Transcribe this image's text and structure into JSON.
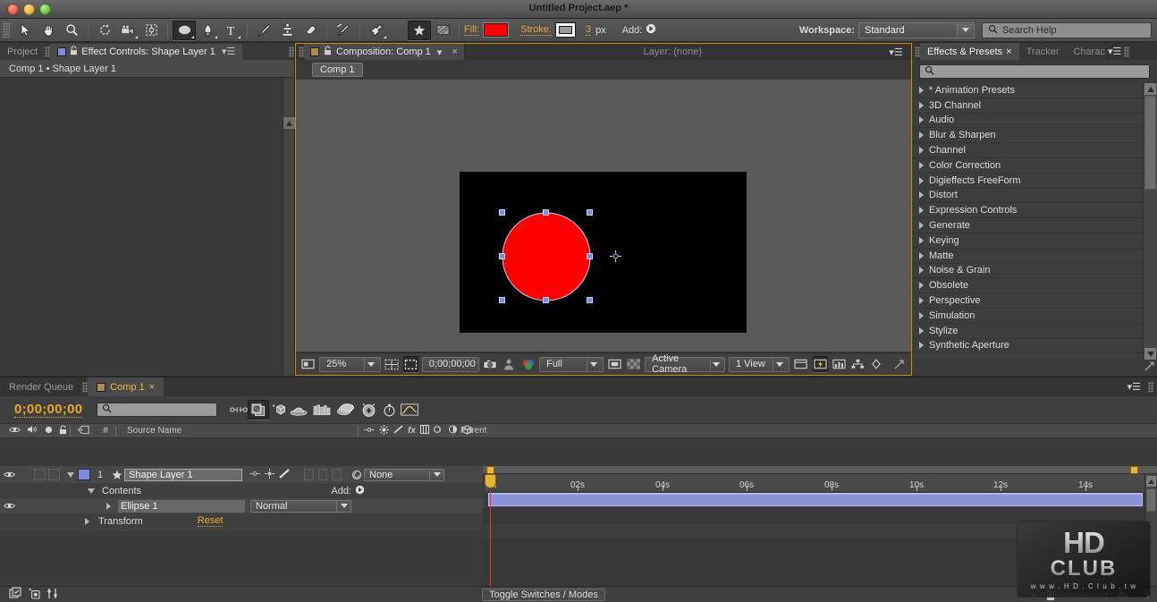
{
  "window": {
    "title": "Untitled Project.aep *",
    "traffic_lights": [
      "close-button",
      "minimize-button",
      "zoom-button"
    ]
  },
  "toolbar": {
    "tools": [
      {
        "name": "selection-tool",
        "glyph": "selection",
        "selected": false,
        "has_flyout": false
      },
      {
        "name": "hand-tool",
        "glyph": "hand",
        "selected": false,
        "has_flyout": false
      },
      {
        "name": "zoom-tool",
        "glyph": "magnifier",
        "selected": false,
        "has_flyout": false
      },
      {
        "name": "rotation-tool",
        "glyph": "rotate",
        "selected": false,
        "has_flyout": false
      },
      {
        "name": "camera-tool",
        "glyph": "camera",
        "selected": false,
        "has_flyout": true
      },
      {
        "name": "pan-behind-tool",
        "glyph": "pan-behind",
        "selected": false,
        "has_flyout": false
      },
      {
        "name": "shape-tool",
        "glyph": "ellipse",
        "selected": true,
        "has_flyout": true
      },
      {
        "name": "pen-tool",
        "glyph": "pen",
        "selected": false,
        "has_flyout": true
      },
      {
        "name": "type-tool",
        "glyph": "type",
        "selected": false,
        "has_flyout": true
      },
      {
        "name": "brush-tool",
        "glyph": "brush",
        "selected": false,
        "has_flyout": false
      },
      {
        "name": "clone-stamp-tool",
        "glyph": "stamp",
        "selected": false,
        "has_flyout": false
      },
      {
        "name": "eraser-tool",
        "glyph": "eraser",
        "selected": false,
        "has_flyout": false
      },
      {
        "name": "roto-brush-tool",
        "glyph": "roto-brush",
        "selected": false,
        "has_flyout": false
      },
      {
        "name": "puppet-pin-tool",
        "glyph": "puppet-pin",
        "selected": false,
        "has_flyout": true
      }
    ],
    "toggle_buttons": [
      {
        "name": "snapping-toggle",
        "glyph": "star",
        "selected": true
      },
      {
        "name": "transparency-grid-toggle",
        "glyph": "grid",
        "selected": false
      }
    ],
    "fill_label": "Fill:",
    "fill_color": "#ff0000",
    "stroke_label": "Stroke:",
    "stroke_color": "#ffffff",
    "stroke_width": "3",
    "stroke_width_unit": "px",
    "add_label": "Add:",
    "workspace_label": "Workspace:",
    "workspace_value": "Standard",
    "search_help_placeholder": "Search Help"
  },
  "left_panel": {
    "tabs": [
      {
        "label": "Project",
        "active": false,
        "name": "tab-project"
      },
      {
        "label": "Effect Controls: Shape Layer 1",
        "active": true,
        "name": "tab-effect-controls"
      }
    ],
    "header": "Comp 1 • Shape Layer 1"
  },
  "comp_panel": {
    "tabs": [
      {
        "label": "Composition: Comp 1",
        "active": true,
        "name": "tab-composition"
      },
      {
        "label": "Layer: (none)",
        "active": false,
        "name": "tab-layer"
      }
    ],
    "breadcrumb_chip": "Comp 1",
    "viewer": {
      "background_color": "#000000",
      "shape_fill": "#ff0000",
      "shape_stroke": "#c8d0f5",
      "handle_color": "#7b8de0"
    },
    "bottom_bar": {
      "magnification": "25%",
      "current_time": "0;00;00;00",
      "resolution": "Full",
      "view_mode": "Active Camera",
      "view_layout": "1 View",
      "buttons": [
        {
          "name": "region-of-interest-button",
          "glyph": "roi"
        },
        {
          "name": "grid-guides-button",
          "glyph": "grid-guides"
        },
        {
          "name": "mask-region-button",
          "glyph": "mask-region"
        },
        {
          "name": "snapshot-button",
          "glyph": "camera"
        },
        {
          "name": "show-snapshot-button",
          "glyph": "person"
        },
        {
          "name": "channel-button",
          "glyph": "rgb-circles"
        },
        {
          "name": "toggle-alpha-button",
          "glyph": "alpha"
        },
        {
          "name": "transparency-grid-button",
          "glyph": "checkerboard"
        },
        {
          "name": "timeline-button",
          "glyph": "timeline"
        },
        {
          "name": "fast-previews-button",
          "glyph": "lightning"
        },
        {
          "name": "renderer-button",
          "glyph": "renderer"
        },
        {
          "name": "flowchart-button",
          "glyph": "flowchart"
        },
        {
          "name": "exposure-button",
          "glyph": "exposure"
        }
      ]
    }
  },
  "effects_panel": {
    "tabs": [
      {
        "label": "Effects & Presets",
        "active": true,
        "name": "tab-effects-presets"
      },
      {
        "label": "Tracker",
        "active": false,
        "name": "tab-tracker"
      },
      {
        "label": "Charac",
        "active": false,
        "name": "tab-character"
      }
    ],
    "search_value": "",
    "categories": [
      "* Animation Presets",
      "3D Channel",
      "Audio",
      "Blur & Sharpen",
      "Channel",
      "Color Correction",
      "Digieffects FreeForm",
      "Distort",
      "Expression Controls",
      "Generate",
      "Keying",
      "Matte",
      "Noise & Grain",
      "Obsolete",
      "Perspective",
      "Simulation",
      "Stylize",
      "Synthetic Aperture"
    ]
  },
  "timeline": {
    "tabs": [
      {
        "label": "Render Queue",
        "active": false,
        "name": "tab-render-queue"
      },
      {
        "label": "Comp 1",
        "active": true,
        "name": "tab-comp-1"
      }
    ],
    "current_time": "0;00;00;00",
    "search_value": "",
    "toolbar_buttons": [
      {
        "name": "composition-mini-flowchart-button",
        "glyph": "mini-flowchart"
      },
      {
        "name": "draft-3d-button",
        "glyph": "draft-3d",
        "selected": true
      },
      {
        "name": "hide-shy-layers-button",
        "glyph": "shy"
      },
      {
        "name": "frame-blending-button",
        "glyph": "frame-blend"
      },
      {
        "name": "motion-blur-button",
        "glyph": "motion-blur"
      },
      {
        "name": "brainstorm-button",
        "glyph": "brainstorm"
      },
      {
        "name": "auto-keyframe-button",
        "glyph": "stopwatch"
      },
      {
        "name": "graph-editor-button",
        "glyph": "graph-editor"
      }
    ],
    "columns": [
      "#",
      "Source Name",
      "Parent"
    ],
    "column_icons": [
      "eye-icon",
      "audio-icon",
      "solo-icon",
      "lock-icon",
      "label-icon"
    ],
    "switch_icons": [
      "shy-icon",
      "collapse-icon",
      "quality-icon",
      "effects-icon",
      "frame-blend-icon",
      "motion-blur-icon",
      "adjustment-icon",
      "3d-icon"
    ],
    "layers": [
      {
        "index": "1",
        "name": "Shape Layer 1",
        "label_color": "#7b8de0",
        "parent": "None",
        "visible": true,
        "children": [
          {
            "label": "Contents",
            "indent": 1,
            "expanded": true,
            "right_label": "Add:",
            "name": "contents-group"
          },
          {
            "label": "Ellipse 1",
            "indent": 2,
            "expanded": false,
            "blend_mode": "Normal",
            "name": "ellipse-1-group"
          },
          {
            "label": "Transform",
            "indent": 2,
            "expanded": false,
            "right_label": "Reset",
            "name": "transform-group"
          }
        ]
      }
    ],
    "ruler_labels": [
      "0s",
      "02s",
      "04s",
      "06s",
      "08s",
      "10s",
      "12s",
      "14s"
    ],
    "ruler_values": [
      0,
      2,
      4,
      6,
      8,
      10,
      12,
      14
    ],
    "ruler_range": [
      0,
      15
    ],
    "bottom_label": "Toggle Switches / Modes",
    "bottom_buttons": [
      {
        "name": "comp-flowchart-button",
        "glyph": "flowchart"
      },
      {
        "name": "hide-shy-button",
        "glyph": "shy-small"
      },
      {
        "name": "frame-blend-switch-button",
        "glyph": "switches"
      }
    ]
  },
  "watermark": {
    "line1": "HD",
    "line2": "CLUB",
    "url": "w w w . H D . C l u b . t w"
  }
}
